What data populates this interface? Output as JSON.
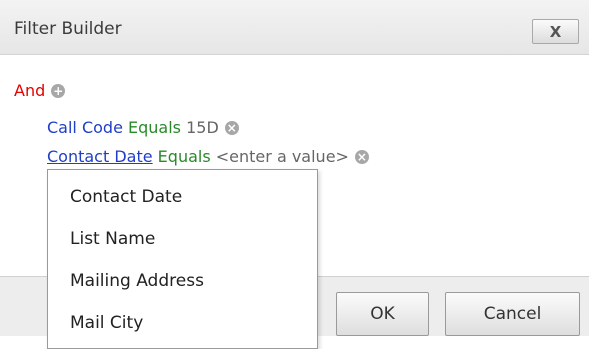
{
  "dialog": {
    "title": "Filter Builder",
    "close_label": "X"
  },
  "filter": {
    "group_operator": "And",
    "group_add_icon": "plus-circle-icon",
    "conditions": [
      {
        "field": "Call Code",
        "operator": "Equals",
        "value": "15D",
        "remove_icon": "x-circle-icon"
      },
      {
        "field": "Contact Date",
        "operator": "Equals",
        "value": "<enter a value>",
        "remove_icon": "x-circle-icon"
      }
    ]
  },
  "field_dropdown": {
    "items": [
      "Contact Date",
      "List Name",
      "Mailing Address",
      "Mail City"
    ]
  },
  "footer": {
    "ok_label": "OK",
    "cancel_label": "Cancel"
  }
}
